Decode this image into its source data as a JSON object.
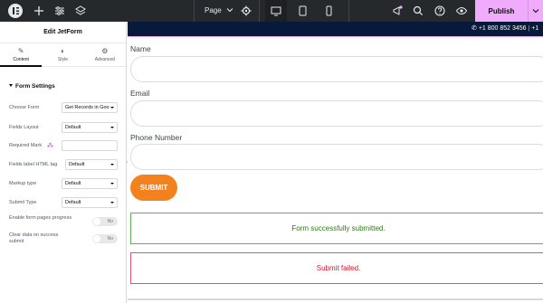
{
  "topbar": {
    "icons": {
      "logo": "elementor-logo",
      "add": "plus-icon",
      "settings": "sliders-icon",
      "structure": "layers-icon"
    },
    "page_label": "Page",
    "publish_label": "Publish"
  },
  "panel": {
    "title": "Edit JetForm",
    "tabs": [
      {
        "label": "Content",
        "icon": "pencil-icon"
      },
      {
        "label": "Style",
        "icon": "half-circle-icon"
      },
      {
        "label": "Advanced",
        "icon": "gear-icon"
      }
    ],
    "section_title": "Form Settings",
    "controls": {
      "choose_form": {
        "label": "Choose Form",
        "value": "Get Records in Goo"
      },
      "fields_layout": {
        "label": "Fields Layout",
        "value": "Default"
      },
      "required_mark": {
        "label": "Required Mark",
        "value": ""
      },
      "fields_label_tag": {
        "label": "Fields label HTML tag",
        "value": "Default"
      },
      "markup_type": {
        "label": "Markup type",
        "value": "Default"
      },
      "submit_type": {
        "label": "Submit Type",
        "value": "Default"
      },
      "enable_progress": {
        "label": "Enable form pages progress",
        "value": "No"
      },
      "clear_data": {
        "label": "Clear data on success submit",
        "value": "No"
      }
    }
  },
  "site": {
    "phone": "+1 800 852 3456",
    "phone_trunc": "+1"
  },
  "form": {
    "name_label": "Name",
    "email_label": "Email",
    "phone_label": "Phone Number",
    "submit_label": "SUBMIT",
    "success_message": "Form successfully submitted.",
    "error_message": "Submit failed."
  },
  "colors": {
    "topbar": "#26292c",
    "publish": "#f0abfc",
    "site_bar": "#081a3b",
    "submit": "#f3821e",
    "success": "#2b7a14",
    "error": "#d11a2a"
  }
}
